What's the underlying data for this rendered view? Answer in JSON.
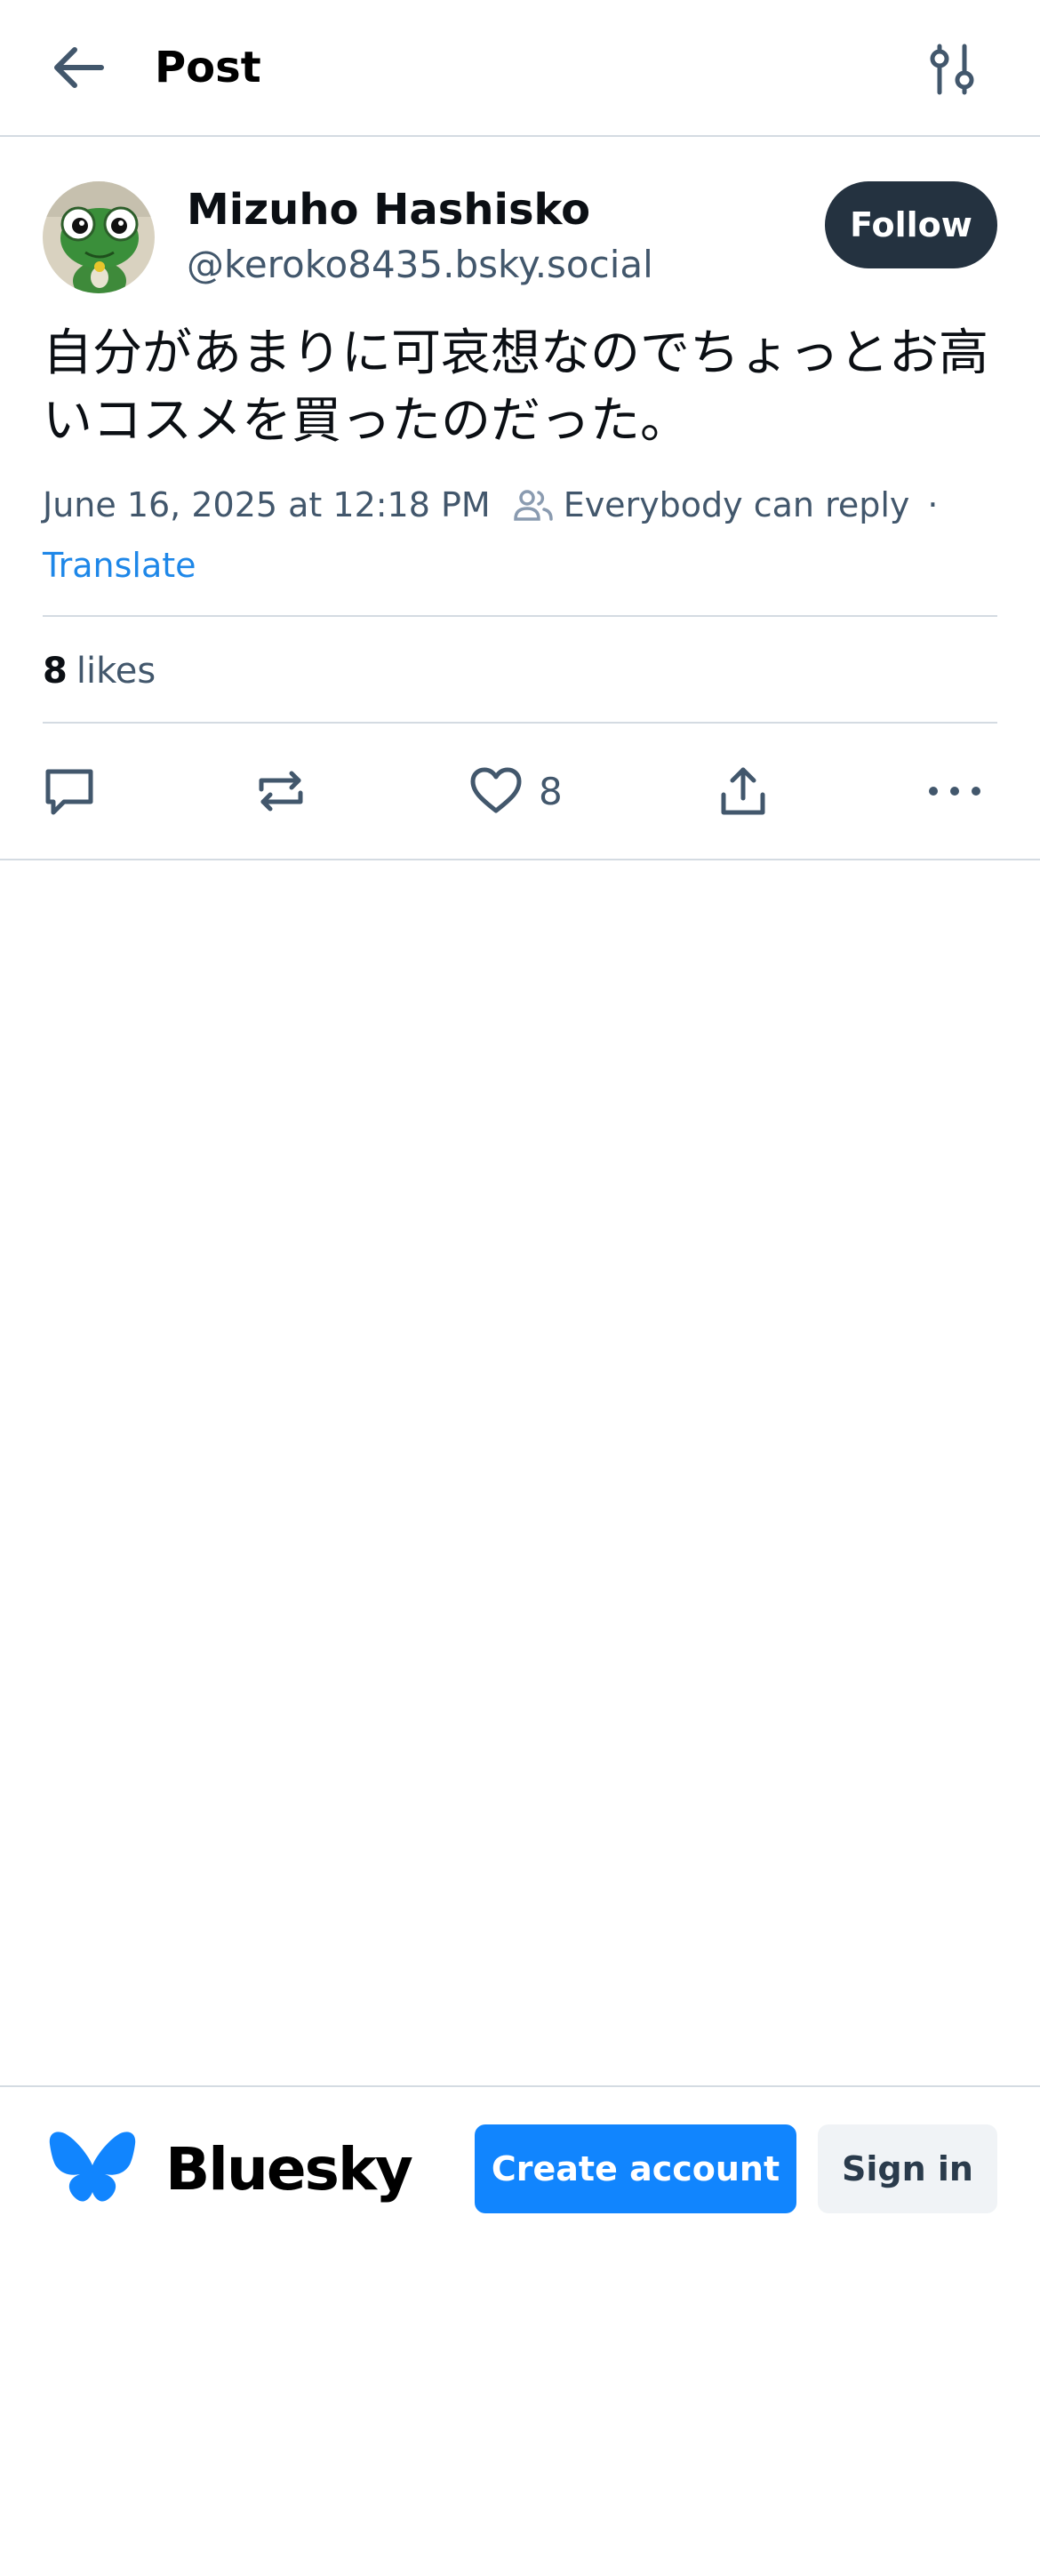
{
  "header": {
    "title": "Post",
    "back_icon": "arrow-left-icon",
    "settings_icon": "sliders-icon"
  },
  "post": {
    "author": {
      "name": "Mizuho Hashisko",
      "handle": "@keroko8435.bsky.social",
      "avatar_icon": "frog-avatar"
    },
    "follow_label": "Follow",
    "text": "自分があまりに可哀想なのでちょっとお高いコスメを買ったのだった。",
    "timestamp": "June 16, 2025 at 12:18 PM",
    "reply_setting": "Everybody can reply",
    "separator": "·",
    "translate_label": "Translate",
    "likes": {
      "count": "8",
      "label": "likes"
    },
    "actions": {
      "reply_icon": "comment-icon",
      "repost_icon": "repost-icon",
      "like_icon": "heart-icon",
      "like_count": "8",
      "share_icon": "share-icon",
      "more_icon": "more-dots-icon"
    }
  },
  "banner": {
    "brand": "Bluesky",
    "logo_icon": "butterfly-logo-icon",
    "create_account_label": "Create account",
    "sign_in_label": "Sign in"
  },
  "colors": {
    "accent": "#1185fe",
    "link": "#1e87e8",
    "follow_bg": "#243240",
    "secondary_text": "#42576c",
    "border": "#d4dbe2"
  }
}
